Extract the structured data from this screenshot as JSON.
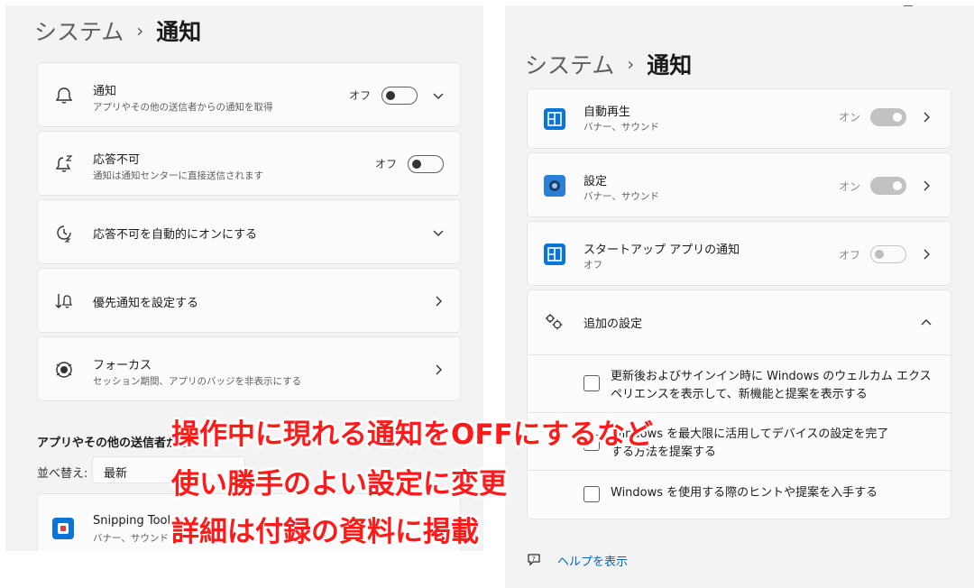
{
  "left": {
    "breadcrumb": {
      "section": "システム",
      "separator": "›",
      "page": "通知"
    },
    "notifications": {
      "title": "通知",
      "subtitle": "アプリやその他の送信者からの通知を取得",
      "state": "オフ"
    },
    "dnd": {
      "title": "応答不可",
      "subtitle": "通知は通知センターに直接送信されます",
      "state": "オフ"
    },
    "dnd_auto": {
      "title": "応答不可を自動的にオンにする"
    },
    "priority": {
      "title": "優先通知を設定する"
    },
    "focus": {
      "title": "フォーカス",
      "subtitle": "セッション期間、アプリのバッジを非表示にする"
    },
    "senders_heading": "アプリやその他の送信者から",
    "sort": {
      "label": "並べ替え:",
      "value": "最新"
    },
    "snipping": {
      "title": "Snipping Tool",
      "subtitle": "バナー、サウンド"
    }
  },
  "right": {
    "window_controls": {
      "minimize": "—",
      "maximize": "☐",
      "close": "✕"
    },
    "breadcrumb": {
      "section": "システム",
      "separator": "›",
      "page": "通知"
    },
    "apps": [
      {
        "title": "自動再生",
        "subtitle": "バナー、サウンド",
        "state": "オン"
      },
      {
        "title": "設定",
        "subtitle": "バナー、サウンド",
        "state": "オン"
      },
      {
        "title": "スタートアップ アプリの通知",
        "subtitle": "オフ",
        "state": "オフ"
      }
    ],
    "additional": {
      "title": "追加の設定",
      "options": [
        {
          "line1": "更新後およびサインイン時に Windows のウェルカム エクス",
          "line2": "ペリエンスを表示して、新機能と提案を表示する"
        },
        {
          "line1": "Windows を最大限に活用してデバイスの設定を完了",
          "line2": "する方法を提案する"
        },
        {
          "line1": "Windows を使用する際のヒントや提案を入手する"
        }
      ]
    },
    "help_link": "ヘルプを表示"
  },
  "overlay": {
    "line1": "操作中に現れる通知をOFFにするなど",
    "line2": "使い勝手のよい設定に変更",
    "line3": "詳細は付録の資料に掲載"
  },
  "colors": {
    "overlay_text": "#ff1a1a",
    "accent": "#0a74d8",
    "background": "#f3f3f3"
  }
}
